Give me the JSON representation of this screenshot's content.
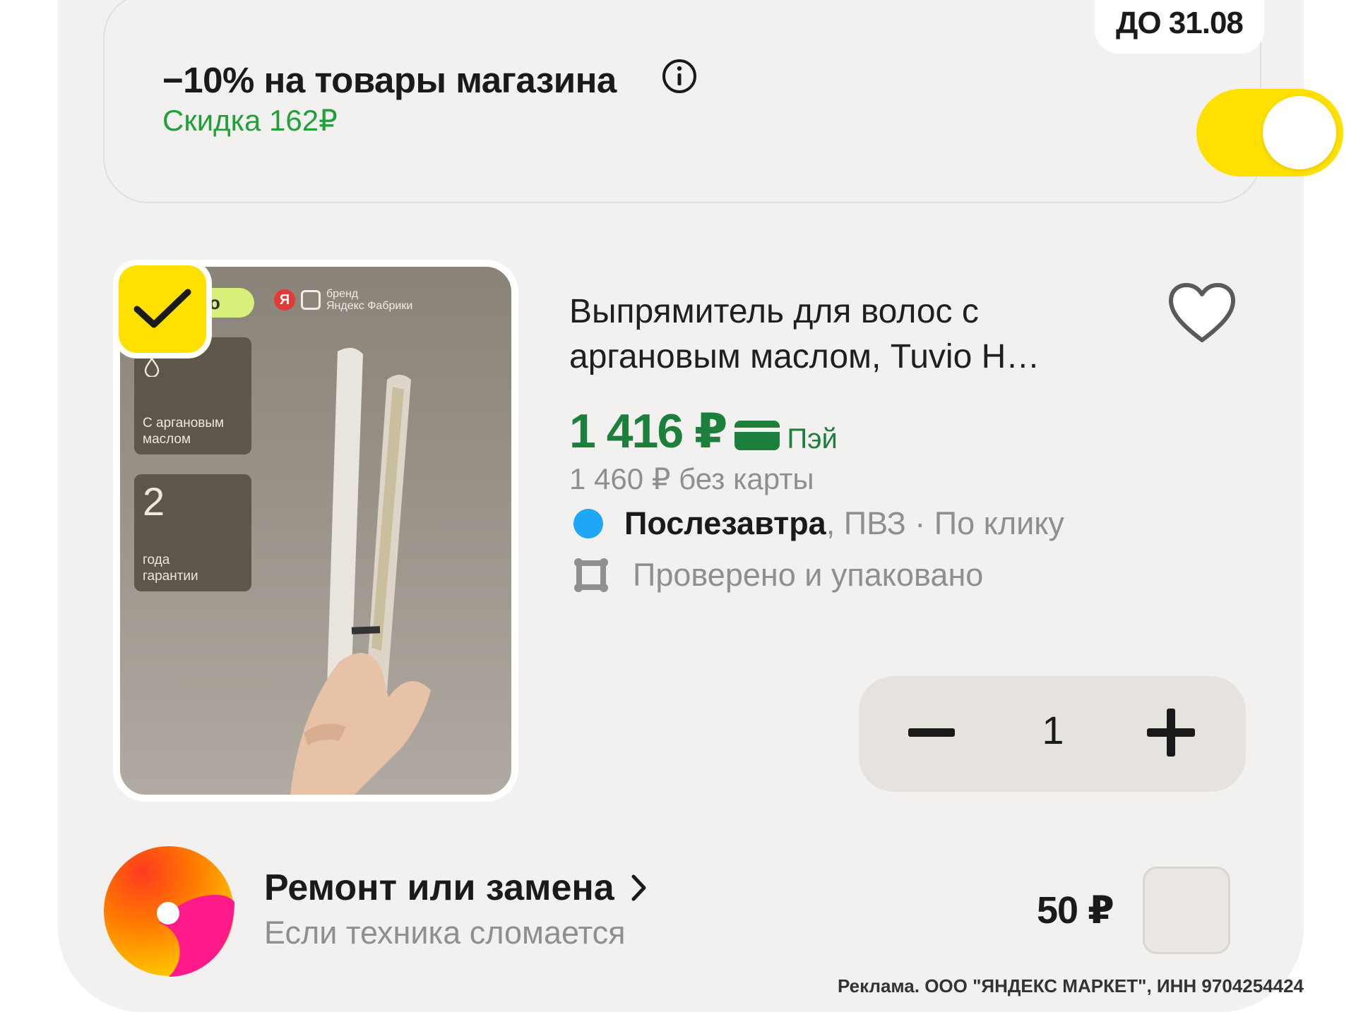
{
  "promo": {
    "title": "−10% на товары магазина",
    "discount_text": "Скидка 162₽",
    "deadline": "ДО 31.08",
    "toggle_on": true,
    "info_icon": "info-icon"
  },
  "product": {
    "selected": true,
    "title": "Выпрямитель для волос с аргановым маслом, Tuvio H…",
    "price": "1 416 ₽",
    "pay_label": "Пэй",
    "price_without_card": "1 460 ₽ без карты",
    "delivery_day": "Послезавтра",
    "delivery_rest": ", ПВЗ · По клику",
    "checked_text": "Проверено и упаковано",
    "quantity": "1",
    "image": {
      "pill_text": "о",
      "brand_mark": "Я",
      "brand_line1": "бренд",
      "brand_line2": "Яндекс Фабрики",
      "tile1_caption_line1": "С аргановым",
      "tile1_caption_line2": "маслом",
      "tile2_number": "2",
      "tile2_caption_line1": "года",
      "tile2_caption_line2": "гарантии"
    },
    "colors": {
      "price": "#1d7f3c",
      "accent": "#ffe000",
      "delivery_dot": "#1ea7f5"
    }
  },
  "service": {
    "title": "Ремонт или замена",
    "subtitle": "Если техника сломается",
    "price": "50 ₽",
    "checked": false
  },
  "ad_note": "Реклама. ООО \"ЯНДЕКС МАРКЕТ\", ИНН 9704254424"
}
